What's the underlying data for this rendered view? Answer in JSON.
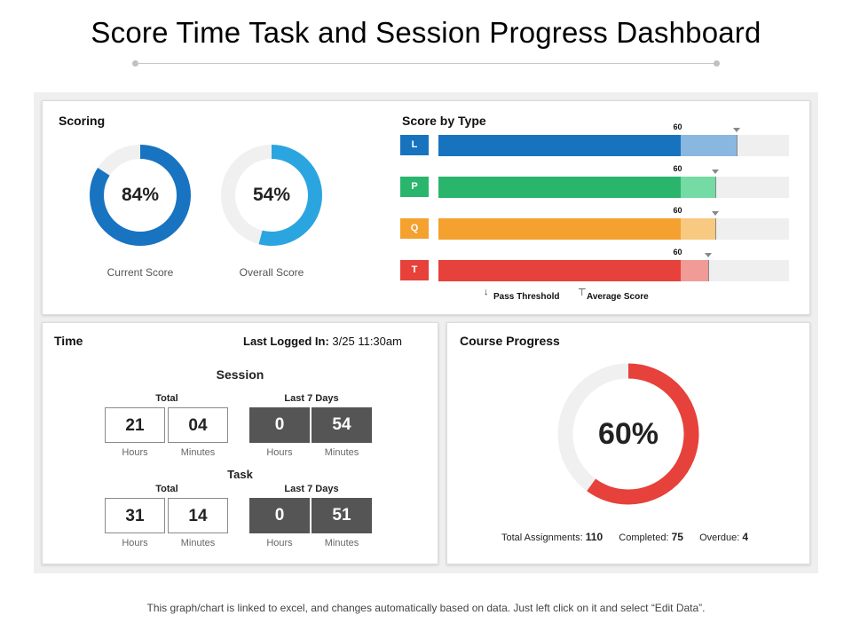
{
  "page": {
    "title": "Score Time Task and Session Progress Dashboard",
    "footer": "This graph/chart is linked to excel, and changes automatically based on data. Just left click on it and select “Edit Data”."
  },
  "scoring": {
    "title": "Scoring",
    "current": {
      "value": 84,
      "display": "84%",
      "label": "Current Score",
      "color": "#1874c1"
    },
    "overall": {
      "value": 54,
      "display": "54%",
      "label": "Overall Score",
      "color": "#2aa5df"
    }
  },
  "score_by_type": {
    "title": "Score by Type",
    "legend_pass": "Pass Threshold",
    "legend_avg": "Average Score",
    "scale_max": 100,
    "types": [
      {
        "code": "L",
        "score": 69,
        "average": 85,
        "threshold": 60,
        "threshold_label": "60",
        "color": "#1873bf",
        "light": "#89b7e0"
      },
      {
        "code": "P",
        "score": 69,
        "average": 79,
        "threshold": 60,
        "threshold_label": "60",
        "color": "#2ab56d",
        "light": "#73dba3"
      },
      {
        "code": "Q",
        "score": 69,
        "average": 79,
        "threshold": 60,
        "threshold_label": "60",
        "color": "#f4a12f",
        "light": "#f8c980"
      },
      {
        "code": "T",
        "score": 69,
        "average": 77,
        "threshold": 60,
        "threshold_label": "60",
        "color": "#e6413a",
        "light": "#f09b96"
      }
    ]
  },
  "time": {
    "title": "Time",
    "last_logged_label": "Last Logged In:",
    "last_logged_value": "3/25  11:30am",
    "session": {
      "heading": "Session",
      "total_label": "Total",
      "last7_label": "Last 7 Days",
      "total": {
        "hours": "21",
        "minutes": "04"
      },
      "last7": {
        "hours": "0",
        "minutes": "54"
      }
    },
    "task": {
      "heading": "Task",
      "total_label": "Total",
      "last7_label": "Last 7 Days",
      "total": {
        "hours": "31",
        "minutes": "14"
      },
      "last7": {
        "hours": "0",
        "minutes": "51"
      }
    },
    "hours_label": "Hours",
    "minutes_label": "Minutes"
  },
  "course_progress": {
    "title": "Course Progress",
    "value": 60,
    "display": "60%",
    "color": "#e6413a",
    "total_label": "Total Assignments:",
    "total_value": "110",
    "completed_label": "Completed:",
    "completed_value": "75",
    "overdue_label": "Overdue:",
    "overdue_value": "4"
  }
}
